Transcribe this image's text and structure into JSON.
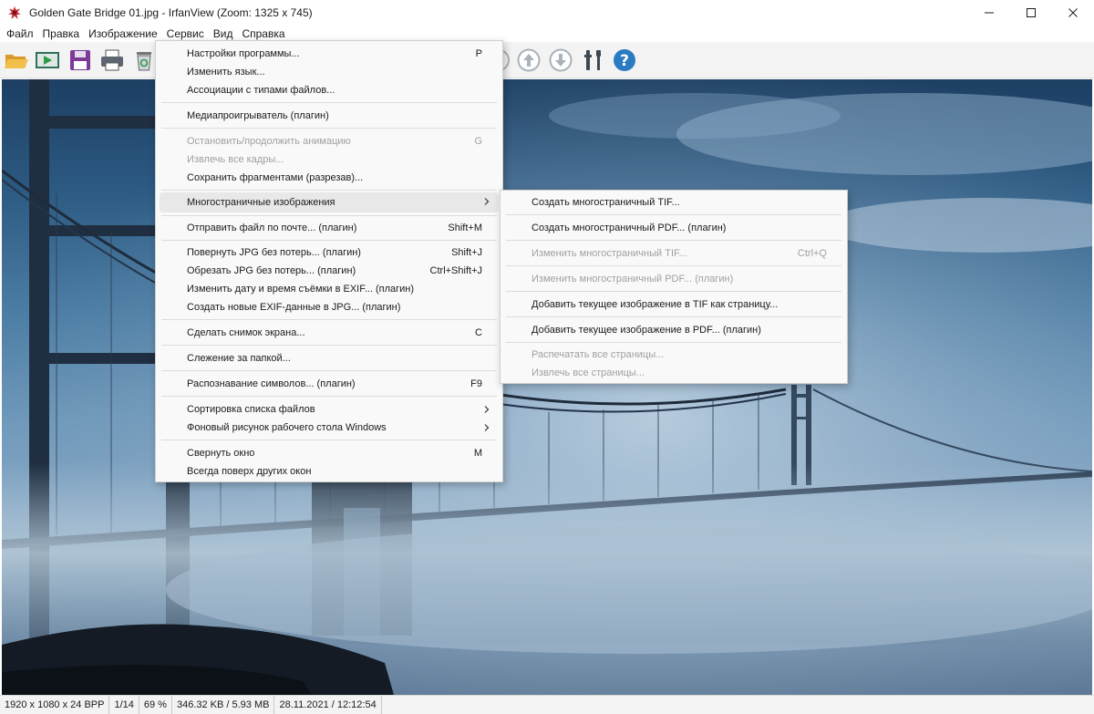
{
  "window": {
    "title": "Golden Gate Bridge 01.jpg - IrfanView (Zoom: 1325 x 745)",
    "icon": "irfanview-logo-icon",
    "controls": [
      "minimize-icon",
      "maximize-icon",
      "close-icon"
    ]
  },
  "menubar": {
    "items": [
      "Файл",
      "Правка",
      "Изображение",
      "Сервис",
      "Вид",
      "Справка"
    ],
    "active": "Сервис"
  },
  "toolbar": {
    "buttons": [
      "open-folder-icon",
      "slideshow-icon",
      "save-icon",
      "print-icon",
      "recycle-bin-icon",
      "next-page-icon",
      "scroll-up-icon",
      "scroll-down-icon",
      "tools-icon",
      "help-icon"
    ]
  },
  "tools_menu": {
    "items": [
      {
        "label": "Настройки программы...",
        "shortcut": "P",
        "enabled": true
      },
      {
        "label": "Изменить язык...",
        "shortcut": "",
        "enabled": true
      },
      {
        "label": "Ассоциации с типами файлов...",
        "shortcut": "",
        "enabled": true
      },
      {
        "label": "Медиапроигрыватель (плагин)",
        "shortcut": "",
        "enabled": true
      },
      {
        "label": "Остановить/продолжить анимацию",
        "shortcut": "G",
        "enabled": false
      },
      {
        "label": "Извлечь все кадры...",
        "shortcut": "",
        "enabled": false
      },
      {
        "label": "Сохранить фрагментами (разрезав)...",
        "shortcut": "",
        "enabled": true
      },
      {
        "label": "Многостраничные изображения",
        "shortcut": "",
        "enabled": true,
        "submenu": true,
        "highlighted": true
      },
      {
        "label": "Отправить файл по почте... (плагин)",
        "shortcut": "Shift+M",
        "enabled": true
      },
      {
        "label": "Повернуть JPG без потерь... (плагин)",
        "shortcut": "Shift+J",
        "enabled": true
      },
      {
        "label": "Обрезать JPG без потерь... (плагин)",
        "shortcut": "Ctrl+Shift+J",
        "enabled": true
      },
      {
        "label": "Изменить дату и время съёмки в EXIF... (плагин)",
        "shortcut": "",
        "enabled": true
      },
      {
        "label": "Создать новые EXIF-данные в JPG... (плагин)",
        "shortcut": "",
        "enabled": true
      },
      {
        "label": "Сделать снимок экрана...",
        "shortcut": "C",
        "enabled": true
      },
      {
        "label": "Слежение за папкой...",
        "shortcut": "",
        "enabled": true
      },
      {
        "label": "Распознавание символов... (плагин)",
        "shortcut": "F9",
        "enabled": true
      },
      {
        "label": "Сортировка списка файлов",
        "shortcut": "",
        "enabled": true,
        "submenu": true
      },
      {
        "label": "Фоновый рисунок рабочего стола Windows",
        "shortcut": "",
        "enabled": true,
        "submenu": true
      },
      {
        "label": "Свернуть окно",
        "shortcut": "M",
        "enabled": true
      },
      {
        "label": "Всегда поверх других окон",
        "shortcut": "",
        "enabled": true
      }
    ]
  },
  "multipage_submenu": {
    "items": [
      {
        "label": "Создать многостраничный TIF...",
        "shortcut": "",
        "enabled": true
      },
      {
        "label": "Создать многостраничный PDF... (плагин)",
        "shortcut": "",
        "enabled": true
      },
      {
        "label": "Изменить многостраничный TIF...",
        "shortcut": "Ctrl+Q",
        "enabled": false
      },
      {
        "label": "Изменить многостраничный PDF... (плагин)",
        "shortcut": "",
        "enabled": false
      },
      {
        "label": "Добавить текущее изображение в TIF как страницу...",
        "shortcut": "",
        "enabled": true
      },
      {
        "label": "Добавить текущее изображение в PDF... (плагин)",
        "shortcut": "",
        "enabled": true
      },
      {
        "label": "Распечатать все страницы...",
        "shortcut": "",
        "enabled": false
      },
      {
        "label": "Извлечь все страницы...",
        "shortcut": "",
        "enabled": false
      }
    ]
  },
  "statusbar": {
    "dimensions": "1920 x 1080 x 24 BPP",
    "position": "1/14",
    "zoom": "69 %",
    "filesize": "346.32 KB / 5.93 MB",
    "datetime": "28.11.2021 / 12:12:54"
  }
}
